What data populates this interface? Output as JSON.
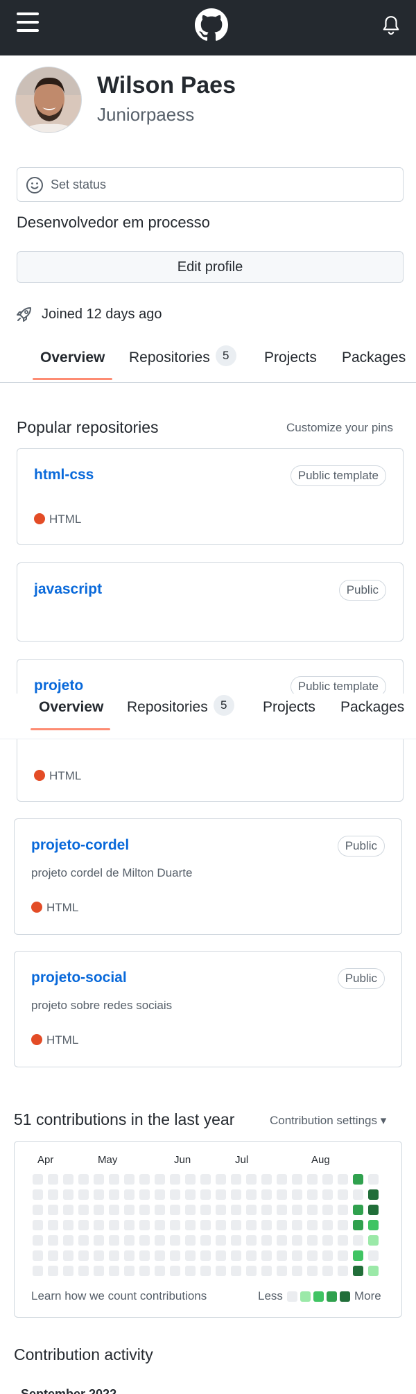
{
  "header": {
    "brand_icon": "github-mark-icon",
    "menu_icon": "hamburger-icon",
    "notification_icon": "bell-icon"
  },
  "profile": {
    "full_name": "Wilson Paes",
    "username": "Juniorpaess",
    "status_placeholder": "Set status",
    "bio": "Desenvolvedor em processo",
    "edit_label": "Edit profile",
    "joined": "Joined 12 days ago"
  },
  "tabs": [
    {
      "label": "Overview",
      "active": true
    },
    {
      "label": "Repositories",
      "count": "5"
    },
    {
      "label": "Projects"
    },
    {
      "label": "Packages"
    }
  ],
  "popular": {
    "title": "Popular repositories",
    "customize": "Customize your pins",
    "repos": [
      {
        "name": "html-css",
        "visibility": "Public template",
        "language": "HTML"
      },
      {
        "name": "javascript",
        "visibility": "Public"
      },
      {
        "name": "projeto",
        "visibility": "Public template",
        "language": "HTML"
      },
      {
        "name": "projeto-cordel",
        "visibility": "Public",
        "description": "projeto cordel de Milton Duarte",
        "language": "HTML"
      },
      {
        "name": "projeto-social",
        "visibility": "Public",
        "description": "projeto sobre redes sociais",
        "language": "HTML"
      }
    ]
  },
  "contributions": {
    "title": "51 contributions in the last year",
    "settings": "Contribution settings",
    "months": [
      "Apr",
      "May",
      "Jun",
      "Jul",
      "Aug"
    ],
    "learn": "Learn how we count contributions",
    "less": "Less",
    "more": "More",
    "colors": {
      "level0": "#ebedf0",
      "level1": "#9be9a8",
      "level2": "#40c463",
      "level3": "#30a14e",
      "level4": "#216e39"
    },
    "last_two_weeks": [
      [
        3,
        0
      ],
      [
        0,
        4
      ],
      [
        3,
        4
      ],
      [
        3,
        2
      ],
      [
        0,
        1
      ],
      [
        2,
        0
      ],
      [
        4,
        1
      ]
    ]
  },
  "activity": {
    "title": "Contribution activity",
    "partial_heading": "September 2022"
  }
}
